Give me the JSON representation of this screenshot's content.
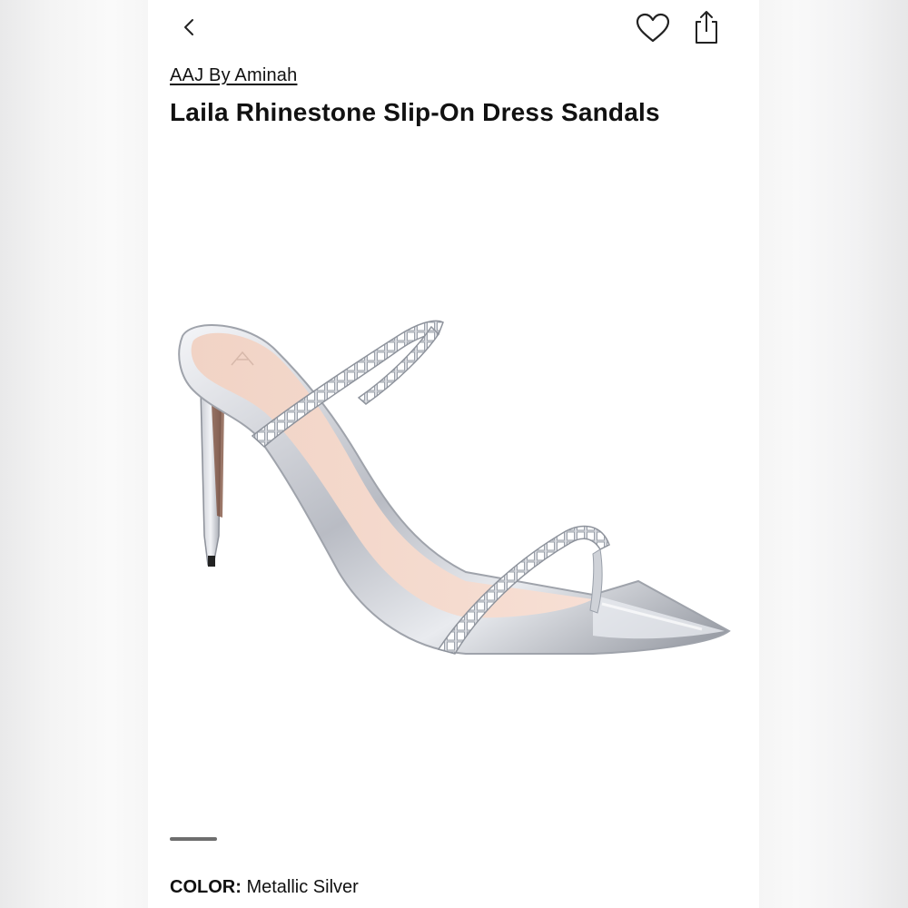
{
  "header": {
    "back_icon": "chevron-left-icon",
    "favorite_icon": "heart-outline-icon",
    "share_icon": "share-icon"
  },
  "product": {
    "brand": "AAJ By Aminah",
    "title": "Laila Rhinestone Slip-On Dress Sandals",
    "image_subject": "silver-rhinestone-stiletto-sandal",
    "color_label": "COLOR:",
    "color_value": "Metallic Silver"
  },
  "carousel": {
    "active_indicator": 1
  },
  "colors": {
    "text": "#111111",
    "indicator": "#6e6e6e",
    "background": "#ffffff"
  }
}
